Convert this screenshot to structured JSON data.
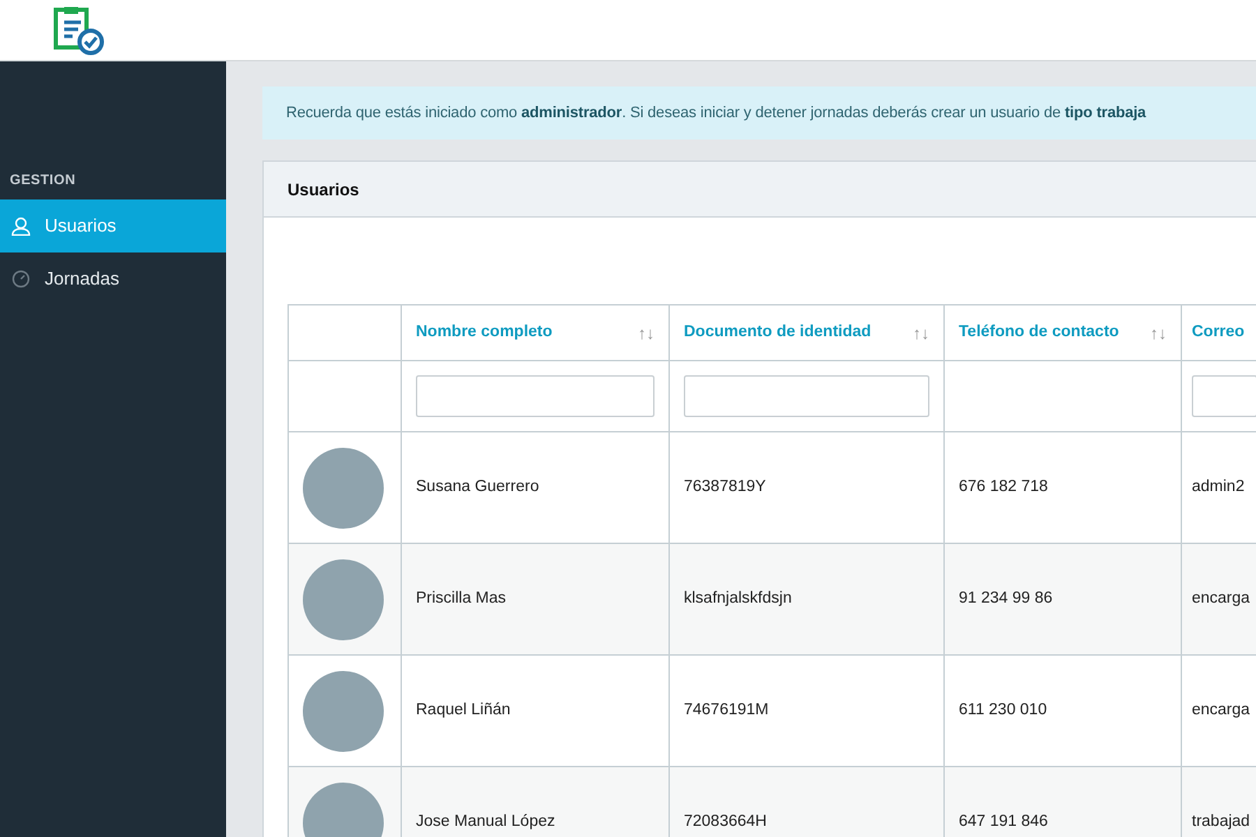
{
  "sidebar": {
    "section": "GESTION",
    "items": [
      {
        "label": "Usuarios",
        "selected": true
      },
      {
        "label": "Jornadas",
        "selected": false
      }
    ]
  },
  "alert": "Recuerda que estás iniciado como **administrador**. Si deseas iniciar y detener jornadas deberás crear un usuario de **tipo trabaja**",
  "card": {
    "title": "Usuarios",
    "table": {
      "columns": [
        {
          "filter": false
        },
        {
          "label": "Nombre completo",
          "sort": "↑↓",
          "filter": true
        },
        {
          "label": "Documento de identidad",
          "sort": "↑↓",
          "filter": true
        },
        {
          "label": "Teléfono de contacto",
          "sort": "↑↓",
          "filter": false
        },
        {
          "label": "Correo",
          "filter": true
        }
      ],
      "rows": [
        {
          "name": "Susana Guerrero",
          "document": "76387819Y",
          "phone": "676 182 718",
          "email": "admin2"
        },
        {
          "name": "Priscilla Mas",
          "document": "klsafnjalskfdsjn",
          "phone": "91 234 99 86",
          "email": "encarga"
        },
        {
          "name": "Raquel Liñán",
          "document": "74676191M",
          "phone": "611 230 010",
          "email": "encarga"
        },
        {
          "name": "Jose Manual López",
          "document": "72083664H",
          "phone": "647 191 846",
          "email": "trabajad"
        }
      ]
    }
  }
}
